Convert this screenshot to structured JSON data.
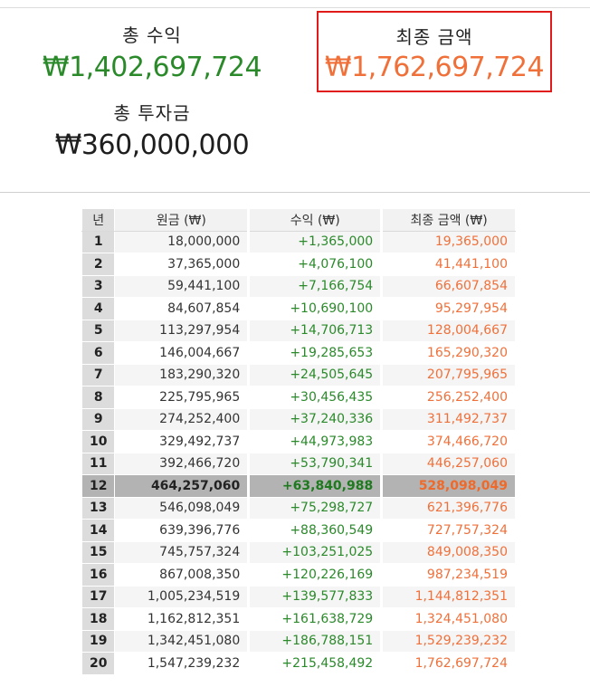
{
  "summary": {
    "total_profit_label": "총 수익",
    "total_profit_value": "₩1,402,697,724",
    "total_investment_label": "총 투자금",
    "total_investment_value": "₩360,000,000",
    "final_amount_label": "최종 금액",
    "final_amount_value": "₩1,762,697,724"
  },
  "colors": {
    "profit": "#2a8a2a",
    "final": "#f0703a",
    "highlight_border": "#e11a1a",
    "highlight_row": "#b3b3b3"
  },
  "table": {
    "headers": [
      "년",
      "원금 (₩)",
      "수익 (₩)",
      "최종 금액 (₩)"
    ],
    "highlight_year": "12",
    "rows": [
      {
        "year": "1",
        "principal": "18,000,000",
        "profit": "+1,365,000",
        "final": "19,365,000"
      },
      {
        "year": "2",
        "principal": "37,365,000",
        "profit": "+4,076,100",
        "final": "41,441,100"
      },
      {
        "year": "3",
        "principal": "59,441,100",
        "profit": "+7,166,754",
        "final": "66,607,854"
      },
      {
        "year": "4",
        "principal": "84,607,854",
        "profit": "+10,690,100",
        "final": "95,297,954"
      },
      {
        "year": "5",
        "principal": "113,297,954",
        "profit": "+14,706,713",
        "final": "128,004,667"
      },
      {
        "year": "6",
        "principal": "146,004,667",
        "profit": "+19,285,653",
        "final": "165,290,320"
      },
      {
        "year": "7",
        "principal": "183,290,320",
        "profit": "+24,505,645",
        "final": "207,795,965"
      },
      {
        "year": "8",
        "principal": "225,795,965",
        "profit": "+30,456,435",
        "final": "256,252,400"
      },
      {
        "year": "9",
        "principal": "274,252,400",
        "profit": "+37,240,336",
        "final": "311,492,737"
      },
      {
        "year": "10",
        "principal": "329,492,737",
        "profit": "+44,973,983",
        "final": "374,466,720"
      },
      {
        "year": "11",
        "principal": "392,466,720",
        "profit": "+53,790,341",
        "final": "446,257,060"
      },
      {
        "year": "12",
        "principal": "464,257,060",
        "profit": "+63,840,988",
        "final": "528,098,049"
      },
      {
        "year": "13",
        "principal": "546,098,049",
        "profit": "+75,298,727",
        "final": "621,396,776"
      },
      {
        "year": "14",
        "principal": "639,396,776",
        "profit": "+88,360,549",
        "final": "727,757,324"
      },
      {
        "year": "15",
        "principal": "745,757,324",
        "profit": "+103,251,025",
        "final": "849,008,350"
      },
      {
        "year": "16",
        "principal": "867,008,350",
        "profit": "+120,226,169",
        "final": "987,234,519"
      },
      {
        "year": "17",
        "principal": "1,005,234,519",
        "profit": "+139,577,833",
        "final": "1,144,812,351"
      },
      {
        "year": "18",
        "principal": "1,162,812,351",
        "profit": "+161,638,729",
        "final": "1,324,451,080"
      },
      {
        "year": "19",
        "principal": "1,342,451,080",
        "profit": "+186,788,151",
        "final": "1,529,239,232"
      },
      {
        "year": "20",
        "principal": "1,547,239,232",
        "profit": "+215,458,492",
        "final": "1,762,697,724"
      }
    ]
  }
}
